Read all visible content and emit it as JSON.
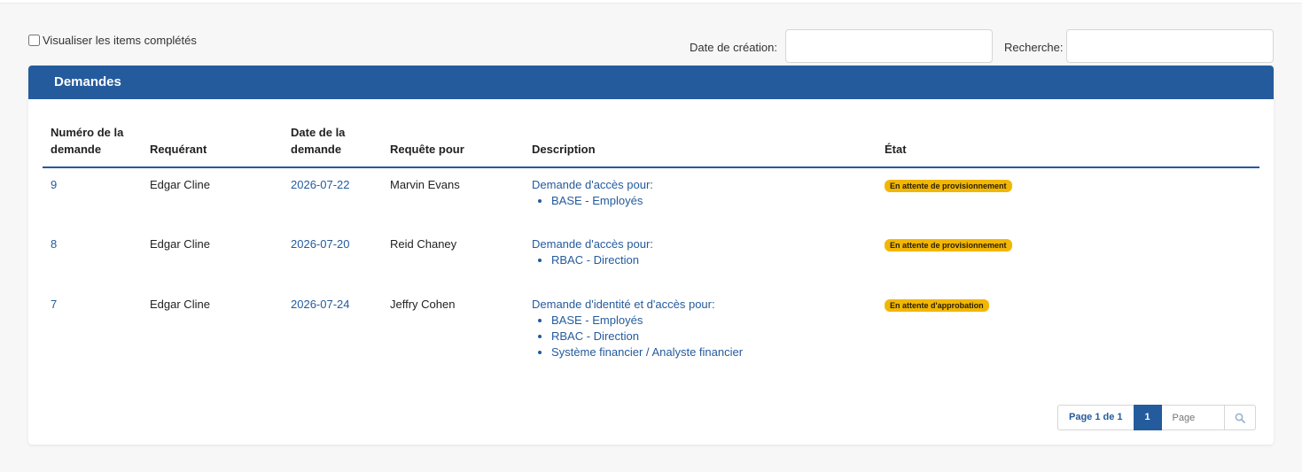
{
  "filters": {
    "show_completed_label": "Visualiser les items complétés",
    "creation_date_label": "Date de création:",
    "creation_date_value": "",
    "search_label": "Recherche:",
    "search_value": ""
  },
  "panel": {
    "title": "Demandes"
  },
  "table": {
    "headers": {
      "number": "Numéro de la demande",
      "requester": "Requérant",
      "date": "Date de la demande",
      "request_for": "Requête pour",
      "description": "Description",
      "state": "État"
    },
    "rows": [
      {
        "number": "9",
        "requester": "Edgar Cline",
        "date": "2026-07-22",
        "request_for": "Marvin Evans",
        "description_title": "Demande d'accès pour:",
        "items": [
          "BASE - Employés"
        ],
        "state": "En attente de provisionnement"
      },
      {
        "number": "8",
        "requester": "Edgar Cline",
        "date": "2026-07-20",
        "request_for": "Reid Chaney",
        "description_title": "Demande d'accès pour:",
        "items": [
          "RBAC - Direction"
        ],
        "state": "En attente de provisionnement"
      },
      {
        "number": "7",
        "requester": "Edgar Cline",
        "date": "2026-07-24",
        "request_for": "Jeffry Cohen",
        "description_title": "Demande d'identité et d'accès pour:",
        "items": [
          "BASE - Employés",
          "RBAC - Direction",
          "Système financier / Analyste financier"
        ],
        "state": "En attente d'approbation"
      }
    ]
  },
  "pagination": {
    "info": "Page 1 de 1",
    "current": "1",
    "page_placeholder": "Page",
    "go_icon": "search-icon"
  },
  "colors": {
    "brand": "#245b9d",
    "badge": "#f2b705"
  }
}
